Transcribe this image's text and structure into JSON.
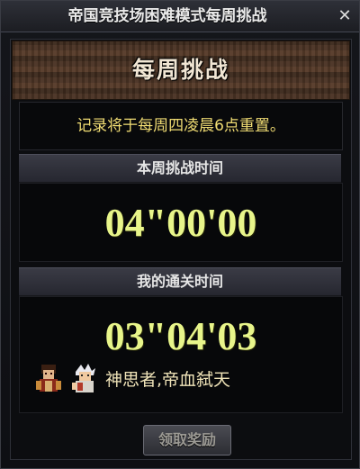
{
  "window": {
    "title": "帝国竞技场困难模式每周挑战",
    "close_glyph": "✕"
  },
  "header": {
    "title": "每周挑战"
  },
  "notice": {
    "text": "记录将于每周四凌晨6点重置。"
  },
  "weekly_time": {
    "label": "本周挑战时间",
    "value": "04\"00'00"
  },
  "my_time": {
    "label": "我的通关时间",
    "value": "03\"04'03"
  },
  "clear_party": {
    "avatars": [
      "character-avatar-1",
      "character-avatar-2"
    ],
    "names": "神思者,帝血弑天"
  },
  "actions": {
    "claim_label": "领取奖励",
    "claim_enabled": false
  },
  "colors": {
    "time_text": "#e8f58a",
    "notice_text": "#f0dc73",
    "wood_banner": "#4a3324"
  }
}
